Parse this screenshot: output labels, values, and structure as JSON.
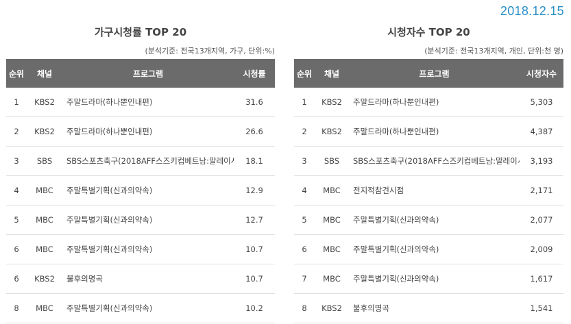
{
  "date": "2018.12.15",
  "chart_data": [
    {
      "type": "table",
      "title": "가구시청률 TOP 20",
      "note": "(분석기준: 전국13개지역, 가구, 단위:%)",
      "columns": [
        "순위",
        "채널",
        "프로그램",
        "시청률"
      ],
      "rows": [
        {
          "rank": "1",
          "channel": "KBS2",
          "program": "주말드라마(하나뿐인내편)",
          "value": "31.6"
        },
        {
          "rank": "2",
          "channel": "KBS2",
          "program": "주말드라마(하나뿐인내편)",
          "value": "26.6"
        },
        {
          "rank": "3",
          "channel": "SBS",
          "program": "SBS스포츠축구(2018AFF스즈키컵베트남:말레이시아)",
          "value": "18.1"
        },
        {
          "rank": "4",
          "channel": "MBC",
          "program": "주말특별기획(신과의약속)",
          "value": "12.9"
        },
        {
          "rank": "5",
          "channel": "MBC",
          "program": "주말특별기획(신과의약속)",
          "value": "12.7"
        },
        {
          "rank": "6",
          "channel": "MBC",
          "program": "주말특별기획(신과의약속)",
          "value": "10.7"
        },
        {
          "rank": "6",
          "channel": "KBS2",
          "program": "불후의명곡",
          "value": "10.7"
        },
        {
          "rank": "8",
          "channel": "MBC",
          "program": "주말특별기획(신과의약속)",
          "value": "10.2"
        }
      ]
    },
    {
      "type": "table",
      "title": "시청자수 TOP 20",
      "note": "(분석기준: 전국13개지역, 개인, 단위:천 명)",
      "columns": [
        "순위",
        "채널",
        "프로그램",
        "시청자수"
      ],
      "rows": [
        {
          "rank": "1",
          "channel": "KBS2",
          "program": "주말드라마(하나뿐인내편)",
          "value": "5,303"
        },
        {
          "rank": "2",
          "channel": "KBS2",
          "program": "주말드라마(하나뿐인내편)",
          "value": "4,387"
        },
        {
          "rank": "3",
          "channel": "SBS",
          "program": "SBS스포츠축구(2018AFF스즈키컵베트남:말레이시아)",
          "value": "3,193"
        },
        {
          "rank": "4",
          "channel": "MBC",
          "program": "전지적참견시점",
          "value": "2,171"
        },
        {
          "rank": "5",
          "channel": "MBC",
          "program": "주말특별기획(신과의약속)",
          "value": "2,077"
        },
        {
          "rank": "6",
          "channel": "MBC",
          "program": "주말특별기획(신과의약속)",
          "value": "2,009"
        },
        {
          "rank": "7",
          "channel": "MBC",
          "program": "주말특별기획(신과의약속)",
          "value": "1,617"
        },
        {
          "rank": "8",
          "channel": "KBS2",
          "program": "불후의명곡",
          "value": "1,541"
        }
      ]
    }
  ]
}
